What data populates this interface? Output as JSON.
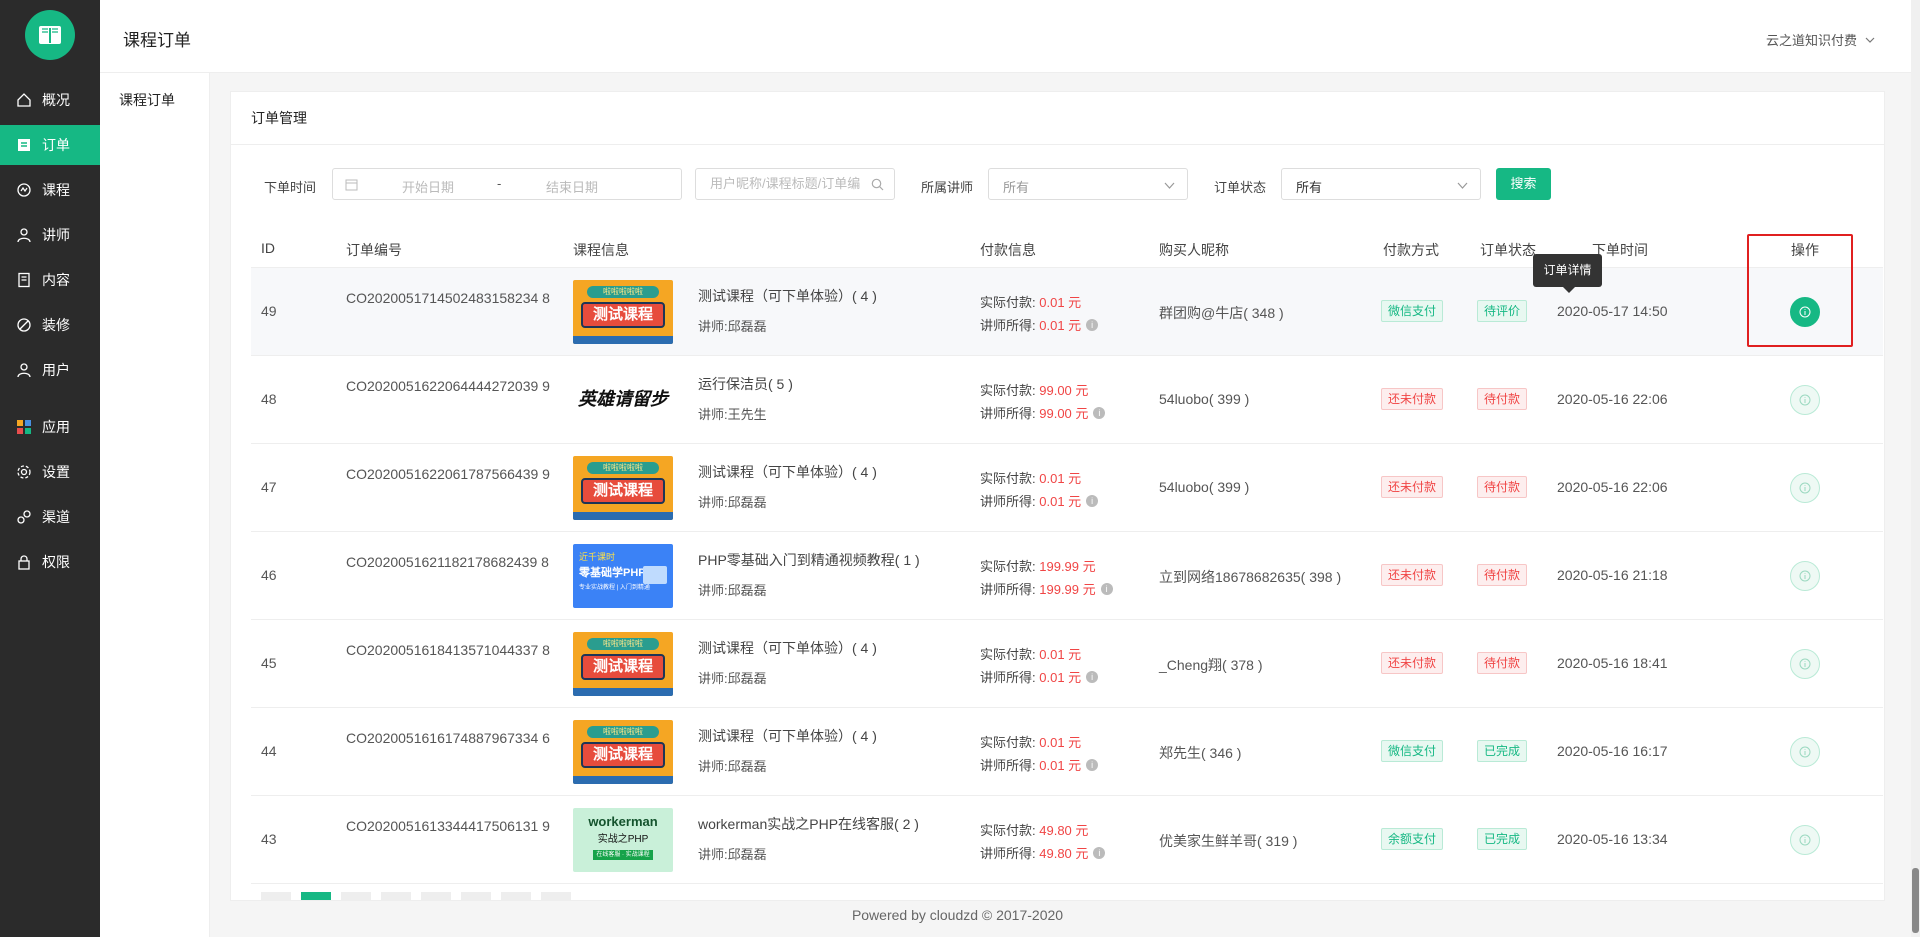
{
  "sidebar": {
    "items": [
      {
        "label": "概况",
        "icon": "home-icon"
      },
      {
        "label": "订单",
        "icon": "order-icon",
        "active": true
      },
      {
        "label": "课程",
        "icon": "course-icon"
      },
      {
        "label": "讲师",
        "icon": "teacher-icon"
      },
      {
        "label": "内容",
        "icon": "content-icon"
      },
      {
        "label": "装修",
        "icon": "decorate-icon"
      },
      {
        "label": "用户",
        "icon": "user-icon"
      },
      {
        "label": "应用",
        "icon": "apps-icon"
      },
      {
        "label": "设置",
        "icon": "settings-icon"
      },
      {
        "label": "渠道",
        "icon": "channel-icon"
      },
      {
        "label": "权限",
        "icon": "lock-icon"
      }
    ]
  },
  "header": {
    "title": "课程订单",
    "tenant": "云之道知识付费"
  },
  "subnav": {
    "item": "课程订单"
  },
  "card": {
    "title": "订单管理"
  },
  "filters": {
    "time_label": "下单时间",
    "start_placeholder": "开始日期",
    "dash": "-",
    "end_placeholder": "结束日期",
    "search_placeholder": "用户昵称/课程标题/订单编号",
    "teacher_label": "所属讲师",
    "teacher_value": "所有",
    "status_label": "订单状态",
    "status_value": "所有",
    "search_button": "搜索"
  },
  "table": {
    "headers": {
      "id": "ID",
      "order_no": "订单编号",
      "course": "课程信息",
      "pay": "付款信息",
      "buyer": "购买人昵称",
      "method": "付款方式",
      "status": "订单状态",
      "time": "下单时间",
      "op": "操作"
    },
    "pay_actual_label": "实际付款:",
    "pay_teacher_label": "讲师所得:",
    "teacher_prefix": "讲师:",
    "rows": [
      {
        "id": "49",
        "order_no": "CO2020051714502483158234 8",
        "thumb": "test",
        "title": "测试课程（可下单体验）( 4 )",
        "teacher": "邱磊磊",
        "actual": "0.01 元",
        "earn": "0.01 元",
        "buyer": "群团购@牛店( 348 )",
        "method": "微信支付",
        "method_tone": "green",
        "status": "待评价",
        "status_tone": "green",
        "time": "2020-05-17 14:50"
      },
      {
        "id": "48",
        "order_no": "CO2020051622064444272039 9",
        "thumb": "calligraphy",
        "title": "运行保洁员( 5 )",
        "teacher": "王先生",
        "actual": "99.00 元",
        "earn": "99.00 元",
        "buyer": "54luobo( 399 )",
        "method": "还未付款",
        "method_tone": "red",
        "status": "待付款",
        "status_tone": "red",
        "time": "2020-05-16 22:06"
      },
      {
        "id": "47",
        "order_no": "CO2020051622061787566439 9",
        "thumb": "test",
        "title": "测试课程（可下单体验）( 4 )",
        "teacher": "邱磊磊",
        "actual": "0.01 元",
        "earn": "0.01 元",
        "buyer": "54luobo( 399 )",
        "method": "还未付款",
        "method_tone": "red",
        "status": "待付款",
        "status_tone": "red",
        "time": "2020-05-16 22:06"
      },
      {
        "id": "46",
        "order_no": "CO2020051621182178682439 8",
        "thumb": "php",
        "title": "PHP零基础入门到精通视频教程( 1 )",
        "teacher": "邱磊磊",
        "actual": "199.99 元",
        "earn": "199.99 元",
        "buyer": "立到网络18678682635( 398 )",
        "method": "还未付款",
        "method_tone": "red",
        "status": "待付款",
        "status_tone": "red",
        "time": "2020-05-16 21:18"
      },
      {
        "id": "45",
        "order_no": "CO2020051618413571044337 8",
        "thumb": "test",
        "title": "测试课程（可下单体验）( 4 )",
        "teacher": "邱磊磊",
        "actual": "0.01 元",
        "earn": "0.01 元",
        "buyer": "_Cheng翔( 378 )",
        "method": "还未付款",
        "method_tone": "red",
        "status": "待付款",
        "status_tone": "red",
        "time": "2020-05-16 18:41"
      },
      {
        "id": "44",
        "order_no": "CO2020051616174887967334 6",
        "thumb": "test",
        "title": "测试课程（可下单体验）( 4 )",
        "teacher": "邱磊磊",
        "actual": "0.01 元",
        "earn": "0.01 元",
        "buyer": "郑先生( 346 )",
        "method": "微信支付",
        "method_tone": "green",
        "status": "已完成",
        "status_tone": "green",
        "time": "2020-05-16 16:17"
      },
      {
        "id": "43",
        "order_no": "CO2020051613344417506131 9",
        "thumb": "workerman",
        "title": "workerman实战之PHP在线客服( 2 )",
        "teacher": "邱磊磊",
        "actual": "49.80 元",
        "earn": "49.80 元",
        "buyer": "优美家生鲜羊哥( 319 )",
        "method": "余额支付",
        "method_tone": "green",
        "status": "已完成",
        "status_tone": "green",
        "time": "2020-05-16 13:34"
      }
    ],
    "tooltip": "订单详情"
  },
  "thumb_text": {
    "test_top": "啦啦啦啦啦",
    "test_main": "测试课程",
    "calligraphy": "英雄请留步",
    "php_top": "近千课时",
    "php_main": "零基础学PHP",
    "php_sub": "专业实战教程 | 入门到精通",
    "wm_main": "workerman",
    "wm_sub": "实战之PHP",
    "wm_foot": "在线客服 · 实战课程"
  },
  "footer": "Powered by cloudzd © 2017-2020",
  "colors": {
    "accent": "#16b884",
    "danger": "#f04545",
    "sidebar": "#2b2b2b"
  }
}
